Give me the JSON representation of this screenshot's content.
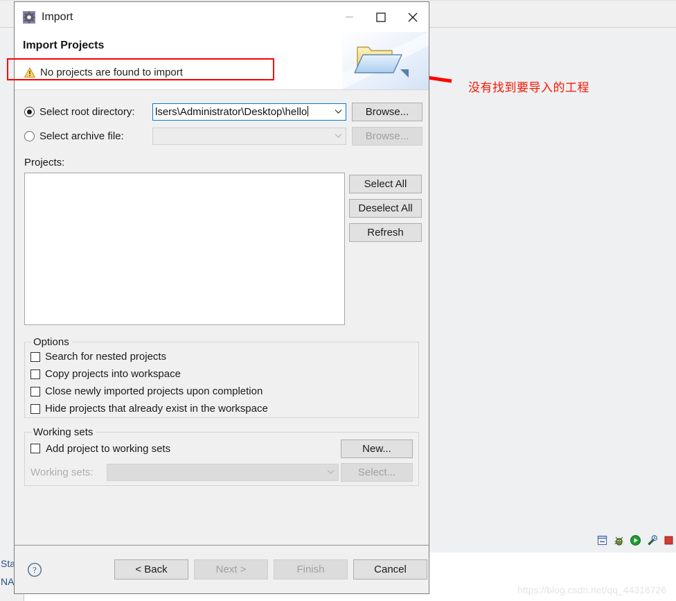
{
  "background": {
    "left_labels": [
      "Star",
      "NAP"
    ],
    "toolbar_icons": [
      {
        "name": "minimize-view-icon"
      },
      {
        "name": "debug-bug-icon"
      },
      {
        "name": "run-play-icon"
      },
      {
        "name": "external-tools-icon"
      },
      {
        "name": "terminate-stop-icon"
      }
    ]
  },
  "annotations": {
    "chinese_note": "没有找到要导入的工程",
    "note_color": "#fc1403",
    "highlight_color": "#fd0000",
    "arrow_color": "#fe0000",
    "watermark": "https://blog.csdn.net/qq_44316726"
  },
  "dialog": {
    "title": "Import",
    "title_icon": "import-gear-icon",
    "window_controls": {
      "minimize": "minimize-icon",
      "maximize": "maximize-icon",
      "close": "close-icon"
    },
    "page_title": "Import Projects",
    "message": {
      "icon": "warning-icon",
      "text": "No projects are found to import"
    },
    "header_graphic": "open-folder-icon",
    "source": {
      "root_directory": {
        "label": "Select root directory:",
        "selected": true,
        "value": "lsers\\Administrator\\Desktop\\hello",
        "browse_label": "Browse..."
      },
      "archive_file": {
        "label": "Select archive file:",
        "selected": false,
        "value": "",
        "placeholder": "",
        "browse_label": "Browse..."
      }
    },
    "projects": {
      "label": "Projects:",
      "items": [],
      "buttons": [
        {
          "label": "Select All",
          "enabled": true
        },
        {
          "label": "Deselect All",
          "enabled": true
        },
        {
          "label": "Refresh",
          "enabled": true
        }
      ]
    },
    "options": {
      "legend": "Options",
      "checkboxes": [
        {
          "label": "Search for nested projects",
          "checked": false
        },
        {
          "label": "Copy projects into workspace",
          "checked": false
        },
        {
          "label": "Close newly imported projects upon completion",
          "checked": false
        },
        {
          "label": "Hide projects that already exist in the workspace",
          "checked": false
        }
      ]
    },
    "working_sets": {
      "legend": "Working sets",
      "add_checkbox": {
        "label": "Add project to working sets",
        "checked": false
      },
      "new_button": {
        "label": "New...",
        "enabled": true
      },
      "field_label": "Working sets:",
      "field_value": "",
      "select_button": {
        "label": "Select...",
        "enabled": false
      }
    },
    "footer": {
      "help_icon": "help-question-icon",
      "buttons": [
        {
          "name": "back",
          "label": "< Back",
          "enabled": true
        },
        {
          "name": "next",
          "label": "Next >",
          "enabled": false
        },
        {
          "name": "finish",
          "label": "Finish",
          "enabled": false
        },
        {
          "name": "cancel",
          "label": "Cancel",
          "enabled": true
        }
      ]
    }
  }
}
